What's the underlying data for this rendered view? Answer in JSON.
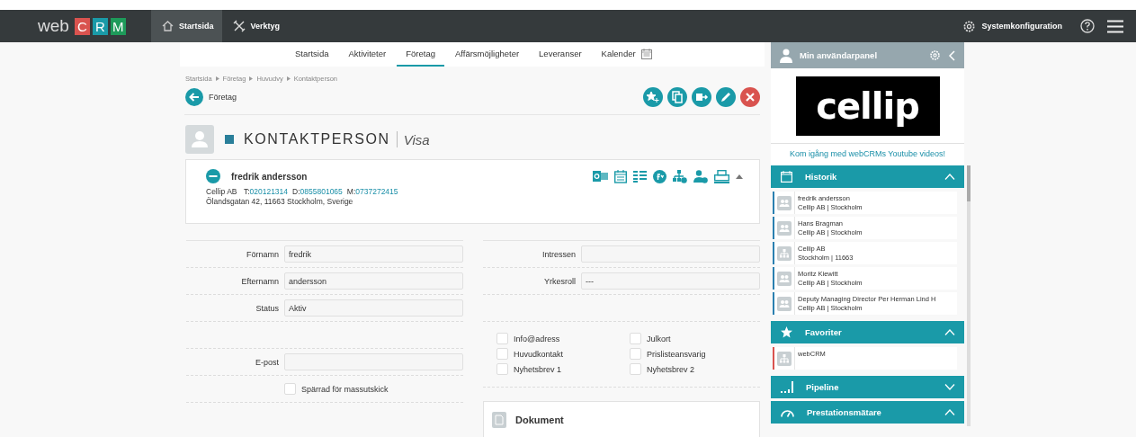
{
  "topbar": {
    "logo": {
      "prefix": "web",
      "letters": [
        {
          "text": "C",
          "color": "#d9534f"
        },
        {
          "text": "R",
          "color": "#1a9aa8"
        },
        {
          "text": "M",
          "color": "#1e9a5a"
        }
      ]
    },
    "nav": [
      {
        "label": "Startsida",
        "selected": true,
        "kind": "home"
      },
      {
        "label": "Verktyg",
        "selected": false,
        "kind": "tools"
      }
    ],
    "system_config": "Systemkonfiguration"
  },
  "subnav": {
    "tabs": [
      {
        "label": "Startsida",
        "selected": false
      },
      {
        "label": "Aktiviteter",
        "selected": false
      },
      {
        "label": "Företag",
        "selected": true
      },
      {
        "label": "Affärsmöjligheter",
        "selected": false
      },
      {
        "label": "Leveranser",
        "selected": false
      },
      {
        "label": "Kalender",
        "selected": false
      }
    ]
  },
  "breadcrumb": [
    "Startsida",
    "Företag",
    "Huvudvy",
    "Kontaktperson"
  ],
  "back_link": "Företag",
  "actions": [
    {
      "kind": "favorite"
    },
    {
      "kind": "copy"
    },
    {
      "kind": "export"
    },
    {
      "kind": "edit"
    },
    {
      "kind": "delete"
    }
  ],
  "heading": {
    "title": "KONTAKTPERSON",
    "mode": "Visa"
  },
  "contact": {
    "name": "fredrik andersson",
    "company": "Cellip AB",
    "phones": [
      {
        "prefix": "T:",
        "number": "020121314"
      },
      {
        "prefix": "D:",
        "number": "0855801065"
      },
      {
        "prefix": "M:",
        "number": "0737272415"
      }
    ],
    "address": "Ölandsgatan 42, 11663 Stockholm, Sverige"
  },
  "form_left": [
    {
      "kind": "field",
      "label": "Förnamn",
      "value": "fredrik"
    },
    {
      "kind": "field",
      "label": "Efternamn",
      "value": "andersson"
    },
    {
      "kind": "field",
      "label": "Status",
      "value": "Aktiv"
    },
    {
      "kind": "blank"
    },
    {
      "kind": "field",
      "label": "E-post"
    }
  ],
  "blocked": {
    "label": "Spärrad för massutskick",
    "checked": false
  },
  "form_right": [
    {
      "label": "Intressen"
    },
    {
      "label": "Yrkesroll",
      "value": "---"
    }
  ],
  "checkboxes": [
    {
      "label": "Info@adress",
      "checked": false
    },
    {
      "label": "Julkort",
      "checked": false
    },
    {
      "label": "Huvudkontakt",
      "checked": false
    },
    {
      "label": "Prislisteansvarig",
      "checked": false
    },
    {
      "label": "Nyhetsbrev 1",
      "checked": false
    },
    {
      "label": "Nyhetsbrev 2",
      "checked": false
    }
  ],
  "documents": {
    "title": "Dokument"
  },
  "panel": {
    "title": "Min användarpanel",
    "logo": "cellip",
    "link": "Kom igång med webCRMs Youtube videos!",
    "sections": [
      {
        "title": "Historik",
        "kind": "history",
        "expanded": true,
        "items": [
          {
            "kind": "person",
            "line1": "fredrik andersson",
            "line2": "Cellip AB | Stockholm",
            "color": "#2a7fb0"
          },
          {
            "kind": "person",
            "line1": "Hans Bragman",
            "line2": "Cellip AB | Stockholm",
            "color": "#2a7fb0"
          },
          {
            "kind": "company",
            "line1": "Cellip AB",
            "line2": "Stockholm | 11663",
            "color": "#2a7fb0"
          },
          {
            "kind": "person",
            "line1": "Moritz Kiewitt",
            "line2": "Cellip AB | Stockholm",
            "color": "#2a7fb0"
          },
          {
            "kind": "person",
            "line1": "Deputy Managing Director Per Herman Lind H",
            "line2": "Cellip AB | Stockholm",
            "color": "#2a7fb0"
          }
        ]
      },
      {
        "title": "Favoriter",
        "kind": "star",
        "expanded": true,
        "items": [
          {
            "kind": "company",
            "line1": "webCRM",
            "color": "#d9534f"
          }
        ]
      },
      {
        "title": "Pipeline",
        "kind": "pipeline",
        "expanded": false
      },
      {
        "title": "Prestationsmätare",
        "kind": "gauge",
        "expanded": true
      }
    ]
  }
}
